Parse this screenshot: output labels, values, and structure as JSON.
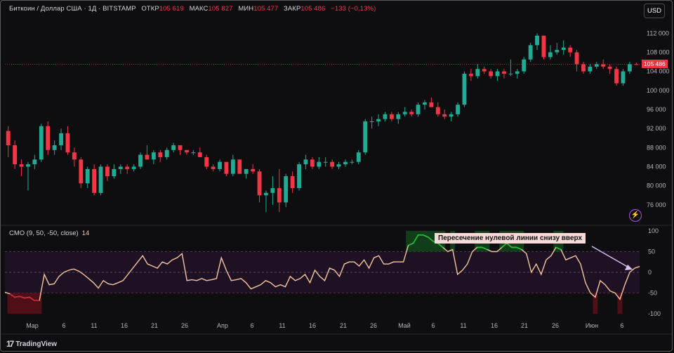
{
  "header": {
    "symbol": "Биткоин / Доллар США · 1Д · BITSTAMP",
    "open_label": "ОТКР",
    "open_value": "105 619",
    "high_label": "МАКС",
    "high_value": "105 827",
    "low_label": "МИН",
    "low_value": "105 477",
    "close_label": "ЗАКР",
    "close_value": "105 486",
    "change": "−133 (−0,13%)",
    "currency_button": "USD"
  },
  "price_tag": "105 486",
  "indicator": {
    "name": "CMO (9, 50, -50, close)",
    "value": "14"
  },
  "annotation": "Пересечение нулевой линии снизу вверх",
  "branding": "TradingView",
  "colors": {
    "up": "#22ab94",
    "down": "#f23645",
    "cmo_line": "#f7c59f",
    "cmo_over": "#1fbf3a",
    "cmo_under": "#d0233a"
  },
  "chart_data": [
    {
      "type": "candlestick",
      "ylim": [
        72000,
        115000
      ],
      "y_ticks": [
        "112 000",
        "108 000",
        "104 000",
        "100 000",
        "96 000",
        "92 000",
        "88 000",
        "84 000",
        "80 000",
        "76 000"
      ],
      "x_ticks": [
        "Мар",
        "6",
        "11",
        "16",
        "21",
        "26",
        "Апр",
        "6",
        "11",
        "16",
        "21",
        "26",
        "Май",
        "6",
        "11",
        "16",
        "21",
        "26",
        "Июн",
        "6"
      ],
      "last_price": 105486,
      "ohlc": [
        [
          91500,
          92500,
          86000,
          88500
        ],
        [
          88500,
          89500,
          83500,
          84500
        ],
        [
          84500,
          85500,
          82000,
          84000
        ],
        [
          84000,
          85000,
          79000,
          84500
        ],
        [
          84500,
          86500,
          83500,
          85500
        ],
        [
          85500,
          93000,
          85000,
          92500
        ],
        [
          92500,
          93500,
          86500,
          87500
        ],
        [
          87500,
          89500,
          86500,
          88500
        ],
        [
          88500,
          92000,
          87500,
          91000
        ],
        [
          91000,
          92500,
          86500,
          87000
        ],
        [
          87000,
          88000,
          84000,
          85500
        ],
        [
          85500,
          86000,
          79500,
          80500
        ],
        [
          80500,
          84000,
          79500,
          83500
        ],
        [
          83500,
          84500,
          78000,
          78500
        ],
        [
          78500,
          84500,
          78000,
          84000
        ],
        [
          84000,
          84500,
          81000,
          82000
        ],
        [
          82000,
          84500,
          81500,
          83500
        ],
        [
          83500,
          84500,
          82500,
          84000
        ],
        [
          84000,
          84500,
          82500,
          83500
        ],
        [
          83500,
          84500,
          83000,
          84000
        ],
        [
          84000,
          87000,
          83500,
          86500
        ],
        [
          86500,
          88500,
          85500,
          85500
        ],
        [
          85500,
          87500,
          84500,
          87000
        ],
        [
          87000,
          87500,
          85000,
          86000
        ],
        [
          86000,
          88000,
          85500,
          87500
        ],
        [
          87500,
          89000,
          87000,
          88500
        ],
        [
          88500,
          88500,
          86500,
          87500
        ],
        [
          87500,
          87500,
          86500,
          87000
        ],
        [
          87000,
          87500,
          86500,
          87000
        ],
        [
          87000,
          88000,
          86000,
          86000
        ],
        [
          86000,
          86500,
          83500,
          84000
        ],
        [
          84000,
          84500,
          83000,
          83500
        ],
        [
          83500,
          85500,
          83000,
          85000
        ],
        [
          85000,
          85000,
          82000,
          82500
        ],
        [
          82500,
          86500,
          82000,
          85500
        ],
        [
          85500,
          85500,
          82500,
          82500
        ],
        [
          82500,
          83500,
          81500,
          83500
        ],
        [
          83500,
          84500,
          82500,
          83000
        ],
        [
          83000,
          83500,
          76500,
          78000
        ],
        [
          78000,
          79000,
          74500,
          78500
        ],
        [
          78500,
          82000,
          76000,
          79500
        ],
        [
          79500,
          83500,
          74500,
          76500
        ],
        [
          76500,
          82500,
          75500,
          82000
        ],
        [
          82000,
          83000,
          78500,
          79500
        ],
        [
          79500,
          85000,
          79000,
          84500
        ],
        [
          84500,
          86500,
          83500,
          85500
        ],
        [
          85500,
          86000,
          83500,
          84000
        ],
        [
          84000,
          86000,
          83500,
          85000
        ],
        [
          85000,
          86000,
          84000,
          85000
        ],
        [
          85000,
          85500,
          83500,
          84000
        ],
        [
          84000,
          85000,
          83500,
          84500
        ],
        [
          84500,
          85500,
          84000,
          85000
        ],
        [
          85000,
          85500,
          84500,
          85000
        ],
        [
          85000,
          87500,
          84500,
          87000
        ],
        [
          87000,
          94000,
          86500,
          93500
        ],
        [
          93500,
          94500,
          92000,
          93500
        ],
        [
          93500,
          95000,
          92500,
          94000
        ],
        [
          94000,
          95500,
          93500,
          95000
        ],
        [
          95000,
          95500,
          93500,
          94000
        ],
        [
          94000,
          95500,
          93000,
          95000
        ],
        [
          95000,
          96500,
          94500,
          95500
        ],
        [
          95500,
          96000,
          94500,
          95000
        ],
        [
          95000,
          97500,
          94500,
          97000
        ],
        [
          97000,
          98000,
          96000,
          97500
        ],
        [
          97500,
          98500,
          96500,
          96500
        ],
        [
          96500,
          97500,
          94500,
          95000
        ],
        [
          95000,
          96000,
          94000,
          94500
        ],
        [
          94500,
          95500,
          93500,
          95000
        ],
        [
          95000,
          97500,
          94500,
          97000
        ],
        [
          97000,
          104000,
          96500,
          103500
        ],
        [
          103500,
          104500,
          102000,
          103000
        ],
        [
          103000,
          105500,
          102500,
          104500
        ],
        [
          104500,
          105000,
          103500,
          104000
        ],
        [
          104000,
          104500,
          102500,
          103000
        ],
        [
          103000,
          104500,
          102000,
          104000
        ],
        [
          104000,
          104500,
          102500,
          103500
        ],
        [
          103500,
          106500,
          103000,
          103500
        ],
        [
          103500,
          104500,
          102500,
          104000
        ],
        [
          104000,
          107000,
          103500,
          106500
        ],
        [
          106500,
          110000,
          106000,
          109500
        ],
        [
          109500,
          112000,
          108500,
          111500
        ],
        [
          111500,
          111500,
          106500,
          107000
        ],
        [
          107000,
          109500,
          106500,
          108000
        ],
        [
          108000,
          110000,
          107500,
          108500
        ],
        [
          108500,
          110500,
          107500,
          109000
        ],
        [
          109000,
          109500,
          107000,
          108000
        ],
        [
          108000,
          108500,
          104000,
          105500
        ],
        [
          105500,
          106000,
          103500,
          104000
        ],
        [
          104000,
          105500,
          103500,
          105000
        ],
        [
          105000,
          106000,
          104500,
          105500
        ],
        [
          105500,
          106500,
          104500,
          105000
        ],
        [
          105000,
          105500,
          103500,
          104500
        ],
        [
          104500,
          105000,
          101000,
          101500
        ],
        [
          101500,
          104500,
          101000,
          104000
        ],
        [
          104000,
          106000,
          103500,
          105500
        ],
        [
          105500,
          105827,
          105477,
          105486
        ]
      ]
    },
    {
      "type": "line",
      "name": "CMO",
      "ylim": [
        -110,
        110
      ],
      "y_ticks": [
        "100",
        "50",
        "0",
        "-50",
        "-100"
      ],
      "levels": [
        100,
        50,
        0,
        -50,
        -100
      ],
      "values": [
        -48,
        -52,
        -60,
        -58,
        -62,
        -60,
        -68,
        -68,
        -5,
        -30,
        -28,
        -10,
        0,
        5,
        8,
        3,
        -5,
        -15,
        -25,
        -38,
        -20,
        -28,
        -30,
        -25,
        -20,
        -5,
        10,
        25,
        40,
        20,
        15,
        10,
        25,
        20,
        30,
        35,
        45,
        -20,
        -18,
        -20,
        -15,
        -20,
        -18,
        -15,
        35,
        5,
        -20,
        -18,
        -15,
        -25,
        -40,
        -35,
        -30,
        -20,
        -25,
        -35,
        -30,
        -35,
        -10,
        -20,
        -15,
        -5,
        -25,
        5,
        -10,
        -20,
        10,
        5,
        -10,
        20,
        25,
        25,
        15,
        30,
        10,
        35,
        40,
        20,
        20,
        25,
        25,
        25,
        65,
        70,
        90,
        90,
        85,
        75,
        70,
        60,
        50,
        55,
        -5,
        5,
        20,
        50,
        60,
        60,
        55,
        50,
        50,
        60,
        70,
        60,
        60,
        55,
        45,
        0,
        20,
        -5,
        30,
        40,
        60,
        55,
        30,
        35,
        40,
        20,
        -25,
        -50,
        -60,
        -20,
        -30,
        -45,
        -50,
        -65,
        -30,
        0,
        10,
        14
      ]
    }
  ]
}
